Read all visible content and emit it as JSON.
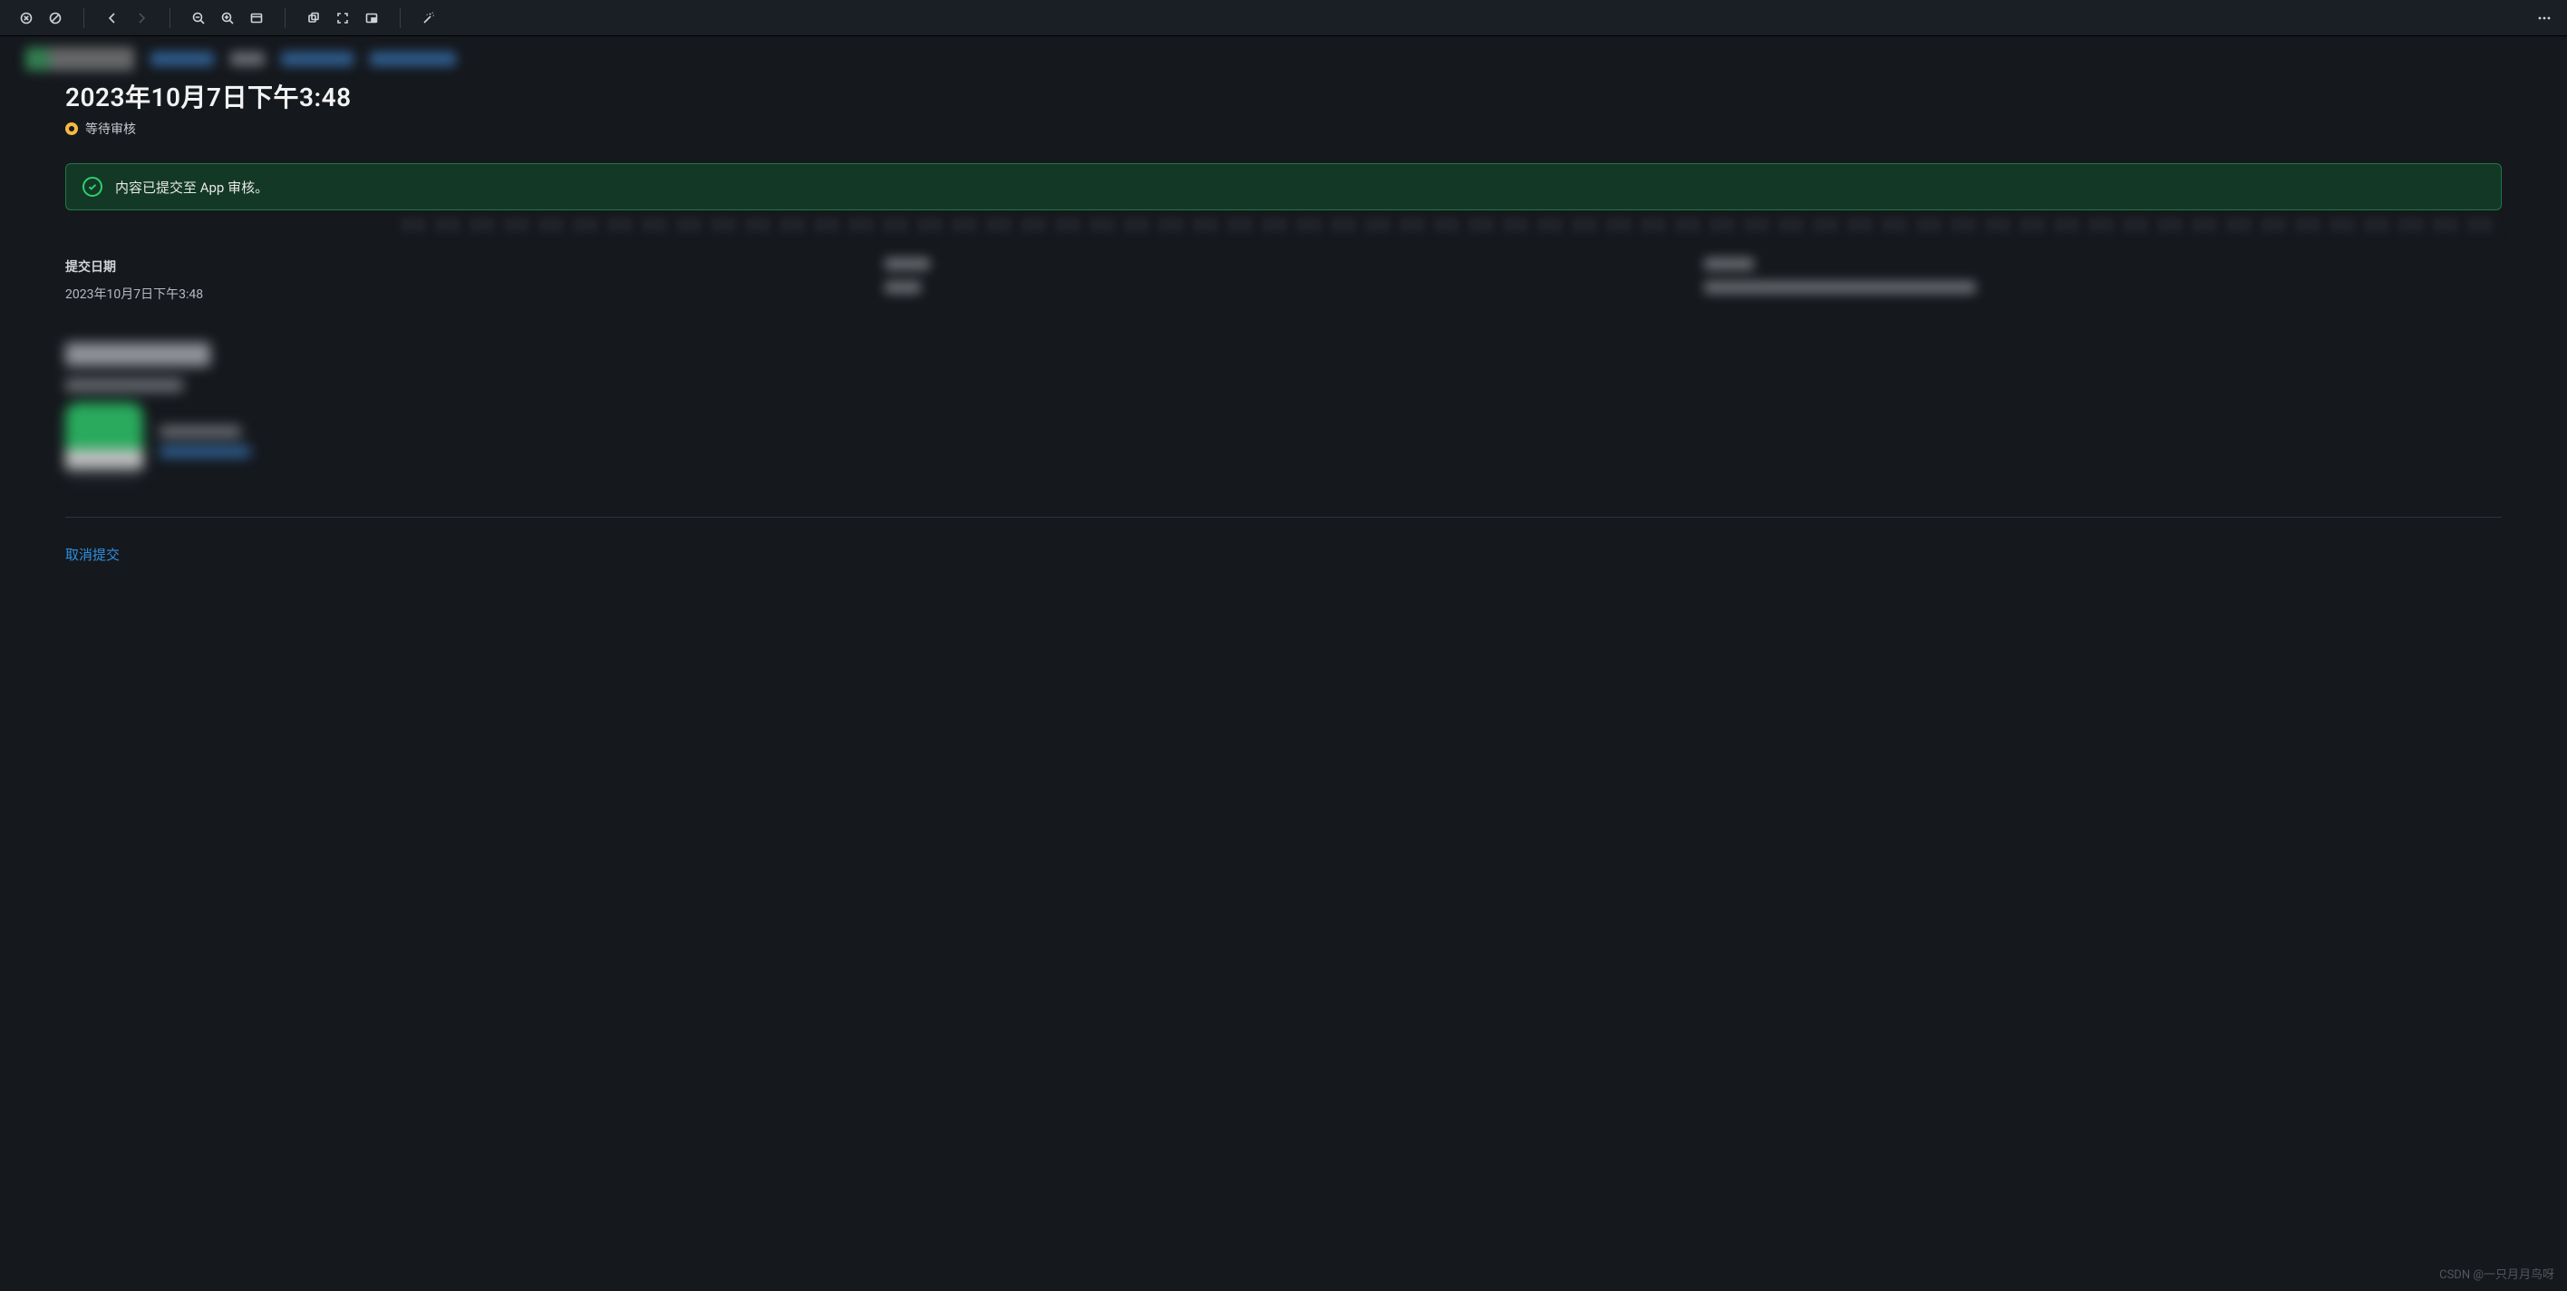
{
  "page": {
    "title": "2023年10月7日下午3:48",
    "status_label": "等待审核"
  },
  "alert": {
    "message": "内容已提交至 App 审核。"
  },
  "details": {
    "col1": {
      "label": "提交日期",
      "value": "2023年10月7日下午3:48"
    }
  },
  "actions": {
    "cancel_label": "取消提交"
  },
  "watermark": "CSDN @一只月月鸟呀"
}
